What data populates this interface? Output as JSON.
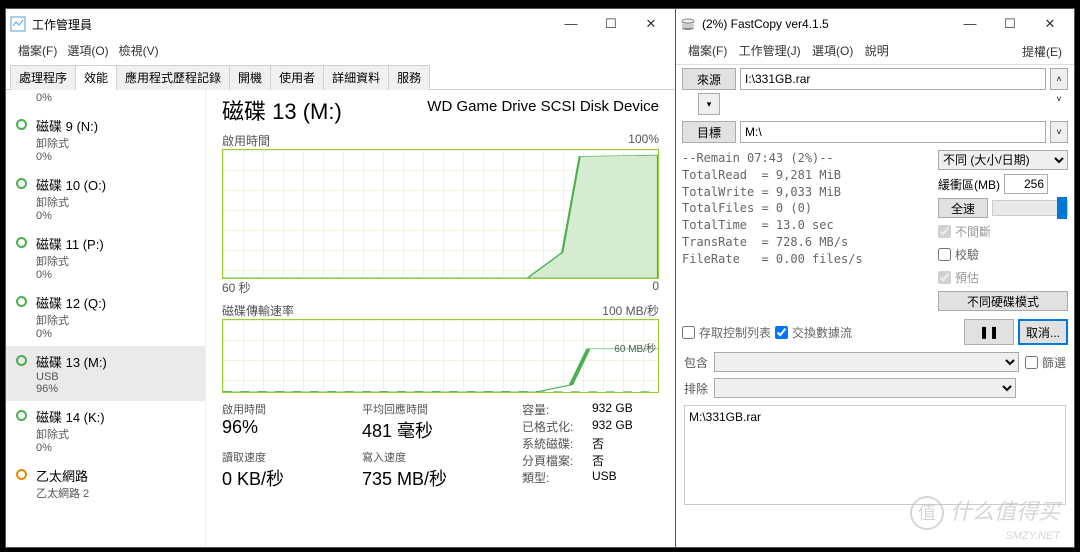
{
  "taskmgr": {
    "title": "工作管理員",
    "menu": [
      "檔案(F)",
      "選項(O)",
      "檢視(V)"
    ],
    "tabs": [
      "處理程序",
      "效能",
      "應用程式歷程記錄",
      "開機",
      "使用者",
      "詳細資料",
      "服務"
    ],
    "active_tab": 1,
    "crumb": "0%",
    "disks": [
      {
        "name": "磁碟 9 (N:)",
        "sub1": "卸除式",
        "sub2": "0%",
        "color": "green"
      },
      {
        "name": "磁碟 10 (O:)",
        "sub1": "卸除式",
        "sub2": "0%",
        "color": "green"
      },
      {
        "name": "磁碟 11 (P:)",
        "sub1": "卸除式",
        "sub2": "0%",
        "color": "green"
      },
      {
        "name": "磁碟 12 (Q:)",
        "sub1": "卸除式",
        "sub2": "0%",
        "color": "green"
      },
      {
        "name": "磁碟 13 (M:)",
        "sub1": "USB",
        "sub2": "96%",
        "color": "green",
        "active": true
      },
      {
        "name": "磁碟 14 (K:)",
        "sub1": "卸除式",
        "sub2": "0%",
        "color": "green"
      },
      {
        "name": "乙太網路",
        "sub1": "乙太網路 2",
        "sub2": "",
        "color": "orange"
      }
    ],
    "heading": "磁碟 13 (M:)",
    "device": "WD Game Drive SCSI Disk Device",
    "chart1": {
      "label": "啟用時間",
      "right": "100%",
      "x0": "60 秒",
      "x1": "0"
    },
    "chart2": {
      "label": "磁碟傳輸速率",
      "right": "100 MB/秒",
      "mid": "60 MB/秒",
      "x0": "",
      "x1": ""
    },
    "stats": [
      {
        "k": "啟用時間",
        "v": "96%"
      },
      {
        "k": "平均回應時間",
        "v": "481 毫秒"
      },
      {
        "k": "讀取速度",
        "v": "0 KB/秒"
      },
      {
        "k": "寫入速度",
        "v": "735 MB/秒"
      }
    ],
    "info": [
      {
        "k": "容量:",
        "v": "932 GB"
      },
      {
        "k": "已格式化:",
        "v": "932 GB"
      },
      {
        "k": "系統磁碟:",
        "v": "否"
      },
      {
        "k": "分頁檔案:",
        "v": "否"
      },
      {
        "k": "類型:",
        "v": "USB"
      }
    ]
  },
  "fastcopy": {
    "title": "(2%) FastCopy ver4.1.5",
    "menu_left": [
      "檔案(F)",
      "工作管理(J)",
      "選項(O)",
      "說明"
    ],
    "menu_right": "提權(E)",
    "source_btn": "來源",
    "source_val": "I:\\331GB.rar",
    "dest_btn": "目標",
    "dest_val": "M:\\",
    "status": "--Remain 07:43 (2%)--\nTotalRead  = 9,281 MiB\nTotalWrite = 9,033 MiB\nTotalFiles = 0 (0)\nTotalTime  = 13.0 sec\nTransRate  = 728.6 MB/s\nFileRate   = 0.00 files/s",
    "mode": "不同 (大小/日期)",
    "buffer_label": "緩衝區(MB)",
    "buffer_val": "256",
    "speed_btn": "全速",
    "chk_nonstop": "不間斷",
    "chk_verify": "校驗",
    "chk_estimate": "預估",
    "btn_diffdisk": "不同硬碟模式",
    "chk_acl": "存取控制列表",
    "chk_stream": "交換數據流",
    "btn_pause": "❚❚",
    "btn_cancel": "取消...",
    "include_label": "包含",
    "exclude_label": "排除",
    "chk_filter": "篩選",
    "log": "M:\\331GB.rar"
  },
  "watermark": "什么值得买\nSMYZ.NET",
  "chart_data": [
    {
      "type": "line",
      "title": "啟用時間",
      "xlabel": "秒",
      "ylabel": "%",
      "ylim": [
        0,
        100
      ],
      "x": [
        60,
        50,
        40,
        30,
        20,
        15,
        10,
        5,
        0
      ],
      "values": [
        0,
        0,
        0,
        0,
        0,
        20,
        95,
        96,
        96
      ]
    },
    {
      "type": "line",
      "title": "磁碟傳輸速率",
      "xlabel": "秒",
      "ylabel": "MB/秒",
      "ylim": [
        0,
        100
      ],
      "x": [
        60,
        50,
        40,
        30,
        20,
        15,
        10,
        5,
        0
      ],
      "values": [
        0,
        0,
        0,
        0,
        0,
        10,
        60,
        60,
        60
      ]
    }
  ]
}
